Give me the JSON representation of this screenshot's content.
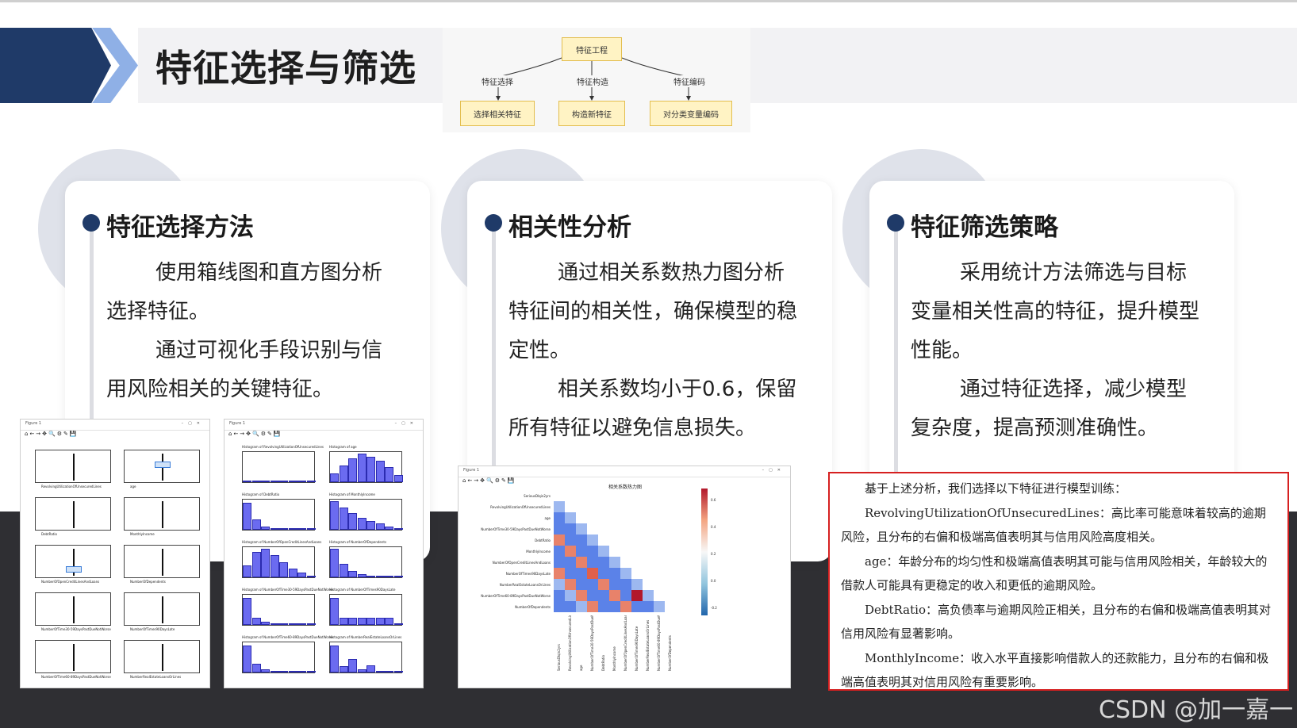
{
  "header": {
    "title": "特征选择与筛选"
  },
  "flow": {
    "root": "特征工程",
    "branches": [
      {
        "label": "特征选择",
        "box": "选择相关特征"
      },
      {
        "label": "特征构造",
        "box": "构造新特征"
      },
      {
        "label": "特征编码",
        "box": "对分类变量编码"
      }
    ]
  },
  "cards": [
    {
      "title": "特征选择方法",
      "paragraphs": [
        "使用箱线图和直方图分析选择特征。",
        "通过可视化手段识别与信用风险相关的关键特征。"
      ]
    },
    {
      "title": "相关性分析",
      "paragraphs": [
        "通过相关系数热力图分析特征间的相关性，确保模型的稳定性。",
        "相关系数均小于0.6，保留所有特征以避免信息损失。"
      ]
    },
    {
      "title": "特征筛选策略",
      "paragraphs": [
        "采用统计方法筛选与目标变量相关性高的特征，提升模型性能。",
        "通过特征选择，减少模型复杂度，提高预测准确性。"
      ]
    }
  ],
  "shots": {
    "window_title": "Figure 1",
    "boxplot_labels": [
      "RevolvingUtilizationOfUnsecuredLines",
      "age",
      "DebtRatio",
      "MonthlyIncome",
      "NumberOfOpenCreditLinesAndLoans",
      "NumberOfDependents",
      "NumberOfTime30-59DaysPastDueNotWorse",
      "NumberOfTimes90DaysLate",
      "NumberOfTime60-89DaysPastDueNotWorse",
      "NumberRealEstateLoansOrLines"
    ],
    "hist_titles": [
      "Histogram of RevolvingUtilizationOfUnsecuredLines",
      "Histogram of age",
      "Histogram of DebtRatio",
      "Histogram of MonthlyIncome",
      "Histogram of NumberOfOpenCreditLinesAndLoans",
      "Histogram of NumberOfDependents",
      "Histogram of NumberOfTime30-59DaysPastDueNotWorse",
      "Histogram of NumberOfTimes90DaysLate",
      "Histogram of NumberOfTime60-89DaysPastDueNotWorse",
      "Histogram of NumberRealEstateLoansOrLines"
    ],
    "heatmap_title": "相关系数热力图",
    "heatmap_rows": [
      "SeriousDlqin2yrs",
      "RevolvingUtilizationOfUnsecuredLines",
      "age",
      "NumberOfTime30-59DaysPastDueNotWorse",
      "DebtRatio",
      "MonthlyIncome",
      "NumberOfOpenCreditLinesAndLoans",
      "NumberOfTimes90DaysLate",
      "NumberRealEstateLoansOrLines",
      "NumberOfTime60-89DaysPastDueNotWorse",
      "NumberOfDependents"
    ],
    "colorbar_ticks": [
      "0.6",
      "0.4",
      "0.2",
      "0.0",
      "-0.2"
    ]
  },
  "excerpt": {
    "paragraphs": [
      "基于上述分析，我们选择以下特征进行模型训练：",
      "RevolvingUtilizationOfUnsecuredLines：高比率可能意味着较高的逾期风险，且分布的右偏和极端高值表明其与信用风险高度相关。",
      "age：年龄分布的均匀性和极端高值表明其可能与信用风险相关，年龄较大的借款人可能具有更稳定的收入和更低的逾期风险。",
      "DebtRatio：高负债率与逾期风险正相关，且分布的右偏和极端高值表明其对信用风险有显著影响。",
      "MonthlyIncome：收入水平直接影响借款人的还款能力，且分布的右偏和极端高值表明其对信用风险有重要影响。"
    ]
  },
  "watermark": "CSDN @加一嘉一",
  "colors": {
    "navy": "#1f3a68",
    "light_blue": "#8fb0e6",
    "red_border": "#d62020"
  }
}
